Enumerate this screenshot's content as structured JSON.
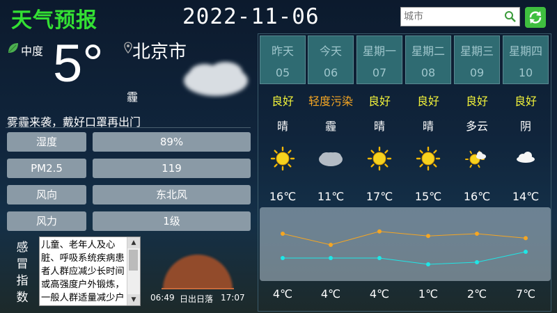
{
  "header": {
    "title": "天气预报",
    "date": "2022-11-06",
    "search_placeholder": "城市"
  },
  "current": {
    "pollution_level": "中度",
    "temperature": "5°",
    "city": "北京市",
    "condition": "霾",
    "tip": "雾霾来袭，戴好口罩再出门",
    "stats": [
      {
        "label": "湿度",
        "value": "89%"
      },
      {
        "label": "PM2.5",
        "value": "119"
      },
      {
        "label": "风向",
        "value": "东北风"
      },
      {
        "label": "风力",
        "value": "1级"
      }
    ],
    "cold_index": {
      "label": "感冒指数",
      "text": "儿童、老年人及心脏、呼吸系统疾病患者人群应减少长时间或高强度户外锻炼，一般人群适量减少户外运动。"
    },
    "sun": {
      "sunrise": "06:49",
      "label": "日出日落",
      "sunset": "17:07"
    }
  },
  "forecast": [
    {
      "day": "昨天",
      "date": "05",
      "aqi": "良好",
      "aqi_color": "#f2f23a",
      "condition": "晴",
      "icon": "sun-icon",
      "high": "16℃",
      "low": "4℃",
      "high_val": 16,
      "low_val": 4
    },
    {
      "day": "今天",
      "date": "06",
      "aqi": "轻度污染",
      "aqi_color": "#f5a623",
      "condition": "霾",
      "icon": "haze-icon",
      "high": "11℃",
      "low": "4℃",
      "high_val": 11,
      "low_val": 4
    },
    {
      "day": "星期一",
      "date": "07",
      "aqi": "良好",
      "aqi_color": "#f2f23a",
      "condition": "晴",
      "icon": "sun-icon",
      "high": "17℃",
      "low": "4℃",
      "high_val": 17,
      "low_val": 4
    },
    {
      "day": "星期二",
      "date": "08",
      "aqi": "良好",
      "aqi_color": "#f2f23a",
      "condition": "晴",
      "icon": "sun-icon",
      "high": "15℃",
      "low": "1℃",
      "high_val": 15,
      "low_val": 1
    },
    {
      "day": "星期三",
      "date": "09",
      "aqi": "良好",
      "aqi_color": "#f2f23a",
      "condition": "多云",
      "icon": "partly-cloudy-icon",
      "high": "16℃",
      "low": "2℃",
      "high_val": 16,
      "low_val": 2
    },
    {
      "day": "星期四",
      "date": "10",
      "aqi": "良好",
      "aqi_color": "#f2f23a",
      "condition": "阴",
      "icon": "cloud-icon",
      "high": "14℃",
      "low": "7℃",
      "high_val": 14,
      "low_val": 7
    }
  ],
  "colors": {
    "high_line": "#f5a623",
    "low_line": "#1fe6e6",
    "title_green": "#33e033"
  }
}
